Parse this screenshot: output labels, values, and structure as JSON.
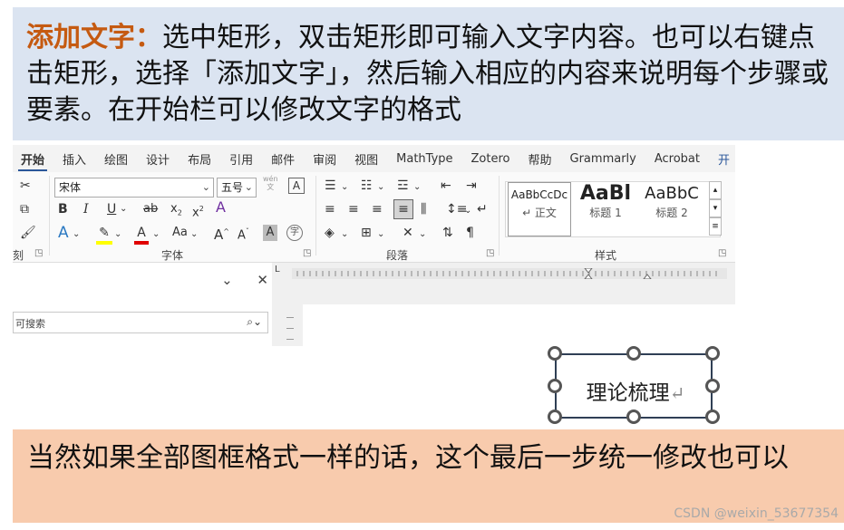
{
  "top_banner": {
    "highlight": "添加文字：",
    "text": "选中矩形，双击矩形即可输入文字内容。也可以右键点击矩形，选择「添加文字」，然后输入相应的内容来说明每个步骤或要素。在开始栏可以修改文字的格式"
  },
  "menubar": {
    "tabs": [
      "开始",
      "插入",
      "绘图",
      "设计",
      "布局",
      "引用",
      "邮件",
      "审阅",
      "视图",
      "MathType",
      "Zotero",
      "帮助",
      "Grammarly",
      "Acrobat",
      "开"
    ]
  },
  "ribbon": {
    "font_name": "宋体",
    "font_size": "五号",
    "wen_top": "wén",
    "wen_bottom": "文",
    "font_group_label": "字体",
    "paragraph_group_label": "段落",
    "styles_group_label": "样式",
    "left_cut_label": "刻",
    "styles": [
      {
        "sample": "AaBbCcDc",
        "name": "↵ 正文"
      },
      {
        "sample": "AaBl",
        "name": "标题 1"
      },
      {
        "sample": "AaBbC",
        "name": "标题 2"
      }
    ]
  },
  "nav": {
    "search_placeholder": "可搜索"
  },
  "shape": {
    "text": "理论梳理",
    "return_mark": "↵"
  },
  "bottom_banner": {
    "text": "当然如果全部图框格式一样的话，这个最后一步统一修改也可以"
  },
  "watermark": "CSDN @weixin_53677354",
  "colors": {
    "top_banner_bg": "#dbe4f1",
    "highlight": "#c55a11",
    "bottom_banner_bg": "#f8cbad"
  }
}
